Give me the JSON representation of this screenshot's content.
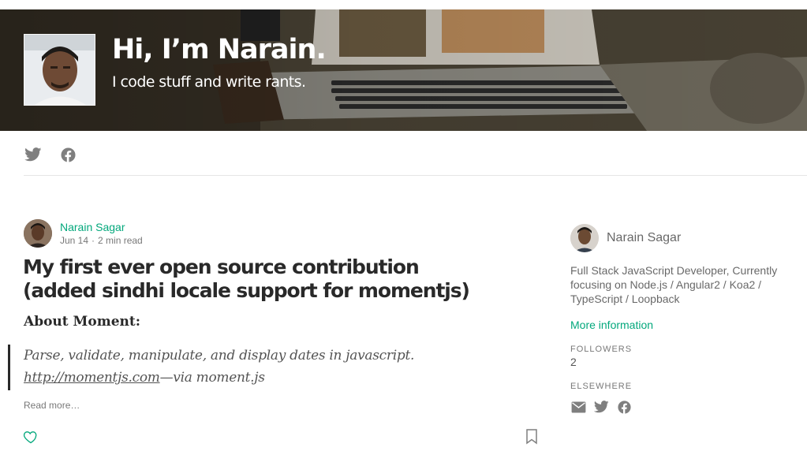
{
  "hero": {
    "title": "Hi, I’m Narain.",
    "tagline": "I code stuff and write rants."
  },
  "social": {
    "icons": [
      "twitter-icon",
      "facebook-icon"
    ]
  },
  "post": {
    "author": "Narain Sagar",
    "date": "Jun 14",
    "separator": "·",
    "read_time": "2 min read",
    "title": "My first ever open source contribution (added sindhi locale support for momentjs)",
    "subhead": "About Moment:",
    "quote_text": "Parse, validate, manipulate, and display dates in javascript.",
    "quote_link": "http://momentjs.com",
    "quote_suffix": "—via moment.js",
    "read_more": "Read more…"
  },
  "sidebar": {
    "name": "Narain Sagar",
    "bio": "Full Stack JavaScript Developer, Currently focusing on Node.js / Angular2 / Koa2 / TypeScript / Loopback",
    "more_link": "More information",
    "followers_label": "FOLLOWERS",
    "followers_count": "2",
    "elsewhere_label": "ELSEWHERE",
    "elsewhere_icons": [
      "mail-icon",
      "twitter-icon",
      "facebook-icon"
    ]
  },
  "colors": {
    "accent_green": "#03a87c",
    "icon_gray": "#7f7f7f"
  }
}
